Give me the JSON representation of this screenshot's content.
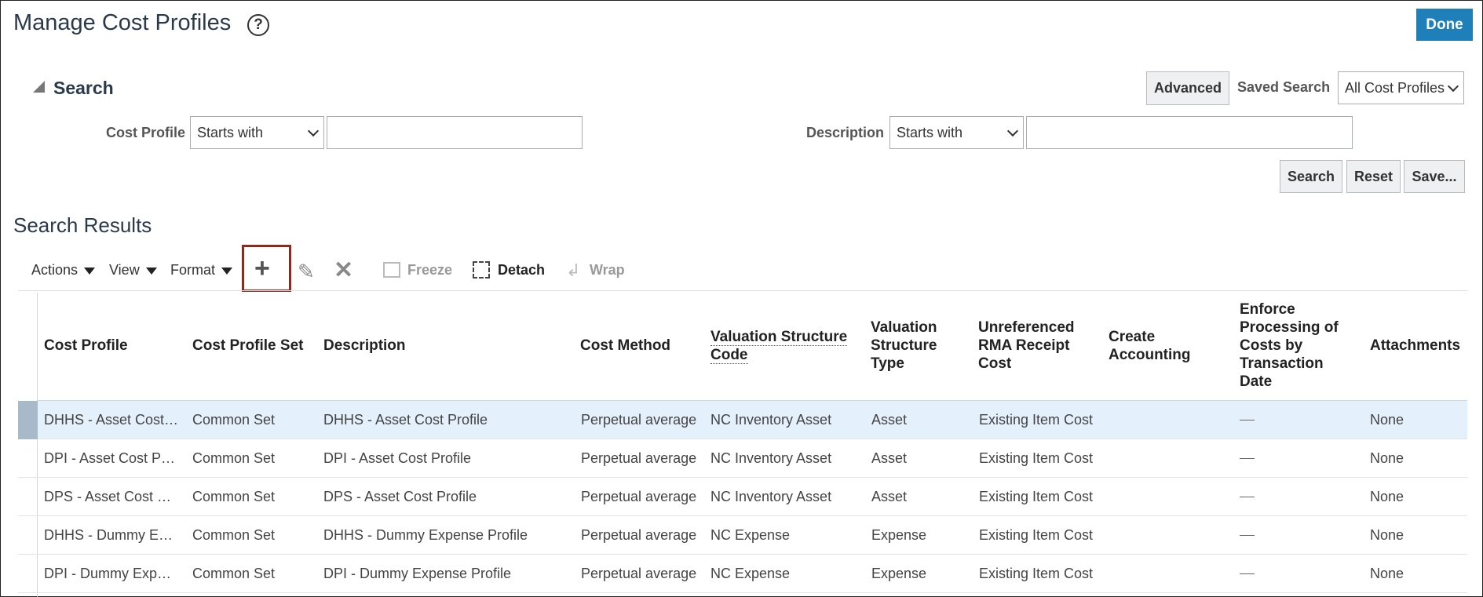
{
  "header": {
    "title": "Manage Cost Profiles",
    "help": "?",
    "done": "Done"
  },
  "search": {
    "heading": "Search",
    "advanced": "Advanced",
    "saved_search_label": "Saved Search",
    "saved_search_value": "All Cost Profiles",
    "cost_profile_label": "Cost Profile",
    "cost_profile_operator": "Starts with",
    "cost_profile_value": "",
    "description_label": "Description",
    "description_operator": "Starts with",
    "description_value": "",
    "search_btn": "Search",
    "reset_btn": "Reset",
    "save_btn": "Save..."
  },
  "results": {
    "title": "Search Results",
    "toolbar": {
      "actions": "Actions",
      "view": "View",
      "format": "Format",
      "freeze": "Freeze",
      "detach": "Detach",
      "wrap": "Wrap"
    },
    "columns": [
      "Cost Profile",
      "Cost Profile Set",
      "Description",
      "Cost Method",
      "Valuation Structure Code",
      "Valuation Structure Type",
      "Unreferenced RMA Receipt Cost",
      "Create Accounting",
      "Enforce Processing of Costs by Transaction Date",
      "Attachments"
    ],
    "rows": [
      {
        "profile": "DHHS - Asset Cost Profile",
        "set": "Common Set",
        "desc": "DHHS - Asset Cost Profile",
        "method": "Perpetual average",
        "code": "NC Inventory Asset",
        "type": "Asset",
        "rma": "Existing Item Cost",
        "acct": "",
        "attach": "None"
      },
      {
        "profile": "DPI - Asset Cost Profile",
        "set": "Common Set",
        "desc": "DPI - Asset Cost Profile",
        "method": "Perpetual average",
        "code": "NC Inventory Asset",
        "type": "Asset",
        "rma": "Existing Item Cost",
        "acct": "",
        "attach": "None"
      },
      {
        "profile": "DPS - Asset Cost Profile",
        "set": "Common Set",
        "desc": "DPS - Asset Cost Profile",
        "method": "Perpetual average",
        "code": "NC Inventory Asset",
        "type": "Asset",
        "rma": "Existing Item Cost",
        "acct": "",
        "attach": "None"
      },
      {
        "profile": "DHHS - Dummy Expense Profile",
        "set": "Common Set",
        "desc": "DHHS - Dummy Expense Profile",
        "method": "Perpetual average",
        "code": "NC Expense",
        "type": "Expense",
        "rma": "Existing Item Cost",
        "acct": "",
        "attach": "None"
      },
      {
        "profile": "DPI - Dummy Expense Profile",
        "set": "Common Set",
        "desc": "DPI - Dummy Expense Profile",
        "method": "Perpetual average",
        "code": "NC Expense",
        "type": "Expense",
        "rma": "Existing Item Cost",
        "acct": "",
        "attach": "None"
      }
    ]
  },
  "colors": {
    "accent": "#1f7fb9",
    "selected_row": "#e4f0fb",
    "highlight_box": "#8b2a1e"
  }
}
